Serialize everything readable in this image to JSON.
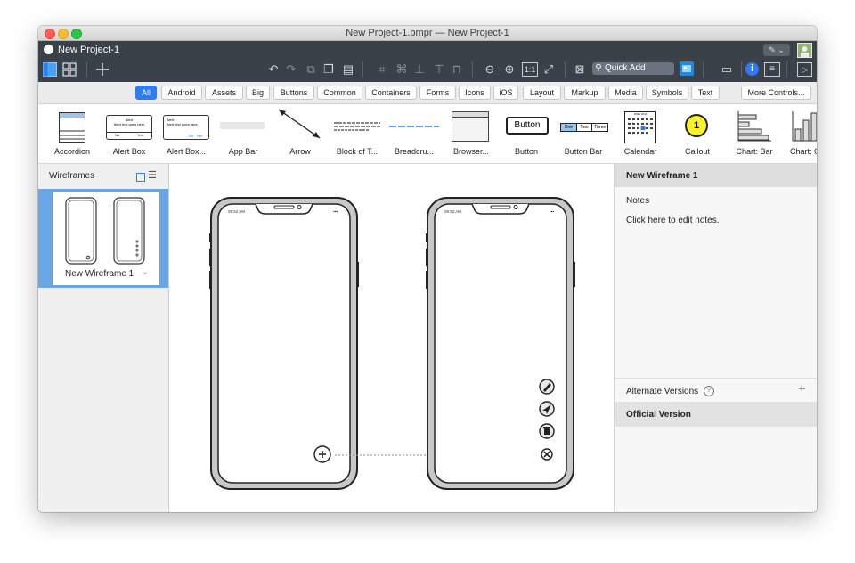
{
  "window": {
    "title": "New Project-1.bmpr — New Project-1"
  },
  "header": {
    "project": "New Project-1",
    "quick_add_placeholder": "Quick Add",
    "zoom_actual": "1:1"
  },
  "categories": [
    {
      "label": "All",
      "selected": true
    },
    {
      "label": "Android"
    },
    {
      "label": "Assets"
    },
    {
      "label": "Big"
    },
    {
      "label": "Buttons"
    },
    {
      "label": "Common"
    },
    {
      "label": "Containers"
    },
    {
      "label": "Forms"
    },
    {
      "label": "Icons"
    },
    {
      "label": "iOS"
    },
    {
      "label": "Layout"
    },
    {
      "label": "Markup"
    },
    {
      "label": "Media"
    },
    {
      "label": "Symbols"
    },
    {
      "label": "Text"
    }
  ],
  "more_controls": "More Controls...",
  "library": {
    "items": [
      "Accordion",
      "Alert Box",
      "Alert Box...",
      "App Bar",
      "Arrow",
      "Block of T...",
      "Breadcru...",
      "Browser...",
      "Button",
      "Button Bar",
      "Calendar",
      "Callout",
      "Chart: Bar",
      "Chart: C"
    ],
    "alert_title": "Alert",
    "alert_body": "Alert text goes here",
    "alert_no": "No",
    "alert_yes": "Yes",
    "button_text": "Button",
    "buttonbar": [
      "One",
      "Two",
      "Three"
    ],
    "calendar_head": "JUNE 2019",
    "callout_number": "1"
  },
  "left_panel": {
    "title": "Wireframes",
    "thumbnail_label": "New Wireframe 1"
  },
  "canvas": {
    "phone_time_1": "09:52 AM",
    "phone_time_2": "09:52 AM"
  },
  "right_panel": {
    "title": "New Wireframe 1",
    "notes_label": "Notes",
    "notes_placeholder": "Click here to edit notes.",
    "alternate_versions": "Alternate Versions",
    "help": "?",
    "official_version": "Official Version"
  },
  "colors": {
    "accent": "#2d7cf6",
    "header": "#3b4149",
    "selection": "#6aa6e6",
    "callout": "#f7f02a"
  }
}
